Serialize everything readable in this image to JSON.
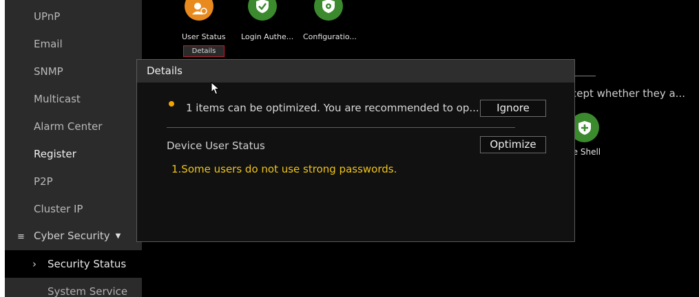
{
  "sidebar": {
    "items": [
      {
        "label": "UPnP"
      },
      {
        "label": "Email"
      },
      {
        "label": "SNMP"
      },
      {
        "label": "Multicast"
      },
      {
        "label": "Alarm Center"
      },
      {
        "label": "Register"
      },
      {
        "label": "P2P"
      },
      {
        "label": "Cluster IP"
      }
    ],
    "group": {
      "icon": "list-icon",
      "label": "Cyber Security"
    },
    "sub_items": [
      {
        "label": "Security Status",
        "selected": true
      },
      {
        "label": "System Service"
      }
    ]
  },
  "top_icons": [
    {
      "label": "User Status",
      "icon": "user-icon",
      "color": "#e98a1e"
    },
    {
      "label": "Login Authe...",
      "icon": "shield-check-icon",
      "color": "#3b8a2e"
    },
    {
      "label": "Configuratio...",
      "icon": "shield-gear-icon",
      "color": "#3b8a2e"
    }
  ],
  "details_tag": "Details",
  "background": {
    "text": "cept whether they a...",
    "shell_icon": "shield-plus-icon",
    "shell_label": "re Shell"
  },
  "dialog": {
    "title": "Details",
    "message": "1 items can be optimized. You are recommended to op...",
    "ignore_label": "Ignore",
    "status_label": "Device User Status",
    "optimize_label": "Optimize",
    "warning": "1.Some users do not use strong passwords.",
    "warning_color": "#f0c419",
    "dot_color": "#f4a300"
  }
}
